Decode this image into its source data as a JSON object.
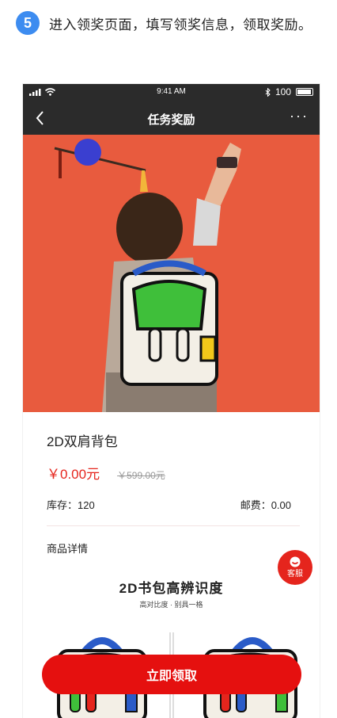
{
  "step": {
    "number": "5",
    "text": "进入领奖页面，填写领奖信息，领取奖励。"
  },
  "status_bar": {
    "time": "9:41 AM",
    "battery": "100"
  },
  "nav": {
    "title": "任务奖励",
    "more": "···"
  },
  "product": {
    "name": "2D双肩背包",
    "price_now": "￥0.00元",
    "price_old": "￥599.00元",
    "stock": "库存：120",
    "shipping": "邮费：0.00",
    "details_heading": "商品详情"
  },
  "service": {
    "label": "客服"
  },
  "promo": {
    "title": "2D书包高辨识度",
    "subtitle": "高对比度 · 别具一格"
  },
  "claim_button": {
    "label": "立即领取"
  },
  "colors": {
    "accent_red": "#e5100f",
    "step_blue": "#3d8cf0",
    "nav_dark": "#2b2b2b",
    "hero_orange": "#e85b3e"
  },
  "icons": [
    "back-icon",
    "signal-icon",
    "wifi-icon",
    "bluetooth-icon",
    "battery-icon",
    "more-icon",
    "service-icon"
  ]
}
